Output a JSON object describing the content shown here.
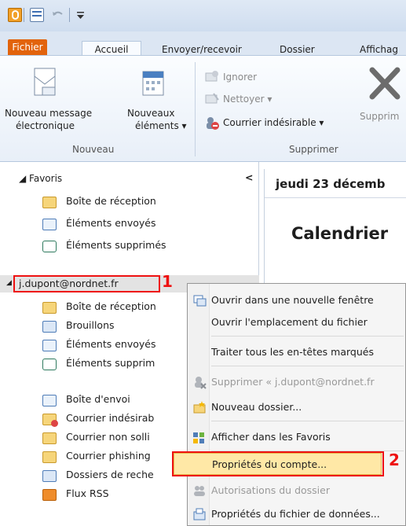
{
  "quick_access": {
    "icons": [
      "outlook-logo-icon",
      "send-receive-icon",
      "undo-icon",
      "customize-dropdown-icon"
    ]
  },
  "tabs": [
    {
      "label": "Fichier"
    },
    {
      "label": "Accueil"
    },
    {
      "label": "Envoyer/recevoir"
    },
    {
      "label": "Dossier"
    },
    {
      "label": "Affichag"
    }
  ],
  "ribbon": {
    "new_message": {
      "line1": "Nouveau message",
      "line2": "électronique"
    },
    "new_items": {
      "line1": "Nouveaux",
      "line2": "éléments ▾"
    },
    "group_new": "Nouveau",
    "ignore": "Ignorer",
    "clean": "Nettoyer ▾",
    "junk": "Courrier indésirable ▾",
    "delete": "Supprim",
    "group_delete": "Supprimer"
  },
  "nav": {
    "favorites_label": "◢ Favoris",
    "collapse": "<",
    "favorites": [
      {
        "label": "Boîte de réception"
      },
      {
        "label": "Éléments envoyés"
      },
      {
        "label": "Éléments supprimés"
      }
    ],
    "account": "j.dupont@nordnet.fr",
    "account_arrow": "◢",
    "folders": [
      {
        "label": "Boîte de réception"
      },
      {
        "label": "Brouillons"
      },
      {
        "label": "Éléments envoyés"
      },
      {
        "label": "Éléments supprim"
      },
      {
        "label": "Boîte d'envoi"
      },
      {
        "label": "Courrier indésirab"
      },
      {
        "label": "Courrier non solli"
      },
      {
        "label": "Courrier phishing"
      },
      {
        "label": "Dossiers de reche"
      },
      {
        "label": "Flux RSS"
      }
    ]
  },
  "reading": {
    "date": "jeudi 23 décemb",
    "title": "Calendrier"
  },
  "annotations": {
    "one": "1",
    "two": "2"
  },
  "menu": {
    "items": [
      {
        "label": "Ouvrir dans une nouvelle fenêtre",
        "enabled": true
      },
      {
        "label": "Ouvrir l'emplacement du fichier",
        "enabled": true
      },
      {
        "label": "Traiter tous les en-têtes marqués",
        "enabled": true
      },
      {
        "label": "Supprimer « j.dupont@nordnet.fr",
        "enabled": false
      },
      {
        "label": "Nouveau dossier...",
        "enabled": true
      },
      {
        "label": "Afficher dans les Favoris",
        "enabled": true
      },
      {
        "label": "Propriétés du compte...",
        "enabled": true
      },
      {
        "label": "Autorisations du dossier",
        "enabled": false
      },
      {
        "label": "Propriétés du fichier de données...",
        "enabled": true
      }
    ]
  },
  "colors": {
    "file_tab": "#e2630c",
    "highlight": "#ffe8a6",
    "annotation_red": "#e11111"
  }
}
